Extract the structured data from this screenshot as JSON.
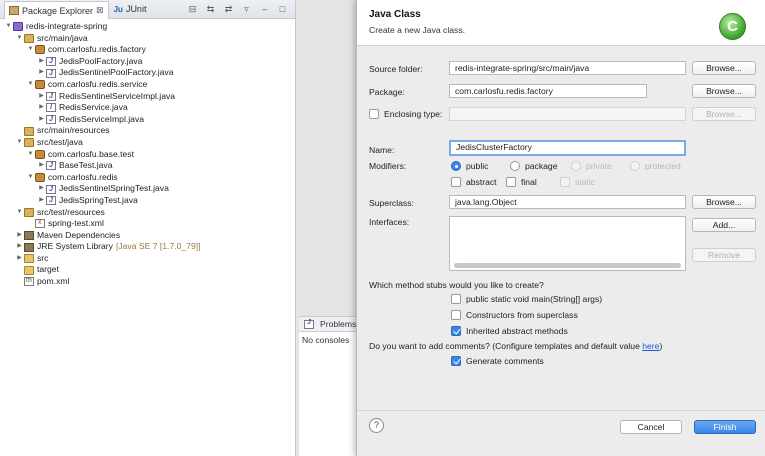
{
  "explorer": {
    "tabs": [
      {
        "label": "Package Explorer"
      },
      {
        "label": "JUnit"
      }
    ],
    "tab_close": "⊠",
    "ju_glyph": "Ju",
    "tools": [
      "⊟",
      "⇆",
      "⇄",
      "▿",
      "–",
      "□"
    ],
    "tree": [
      {
        "label": "redis-integrate-spring",
        "icon": "project-icon",
        "depth": 0,
        "tw": "▼"
      },
      {
        "label": "src/main/java",
        "icon": "source-folder-icon",
        "depth": 1,
        "tw": "▼"
      },
      {
        "label": "com.carlosfu.redis.factory",
        "icon": "package-icon",
        "depth": 2,
        "tw": "▼"
      },
      {
        "label": "JedisPoolFactory.java",
        "icon": "java-file-icon",
        "depth": 3,
        "tw": "▶"
      },
      {
        "label": "JedisSentinelPoolFactory.java",
        "icon": "java-file-icon",
        "depth": 3,
        "tw": "▶"
      },
      {
        "label": "com.carlosfu.redis.service",
        "icon": "package-icon",
        "depth": 2,
        "tw": "▼"
      },
      {
        "label": "RedisSentinelServiceImpl.java",
        "icon": "java-file-icon",
        "depth": 3,
        "tw": "▶"
      },
      {
        "label": "RedisService.java",
        "icon": "interface-file-icon",
        "depth": 3,
        "tw": "▶"
      },
      {
        "label": "RedisServiceImpl.java",
        "icon": "java-file-icon",
        "depth": 3,
        "tw": "▶"
      },
      {
        "label": "src/main/resources",
        "icon": "source-folder-icon",
        "depth": 1,
        "tw": ""
      },
      {
        "label": "src/test/java",
        "icon": "source-folder-icon",
        "depth": 1,
        "tw": "▼"
      },
      {
        "label": "com.carlosfu.base.test",
        "icon": "package-icon",
        "depth": 2,
        "tw": "▼"
      },
      {
        "label": "BaseTest.java",
        "icon": "java-file-icon",
        "depth": 3,
        "tw": "▶"
      },
      {
        "label": "com.carlosfu.redis",
        "icon": "package-icon",
        "depth": 2,
        "tw": "▼"
      },
      {
        "label": "JedisSentinelSpringTest.java",
        "icon": "java-file-icon",
        "depth": 3,
        "tw": "▶"
      },
      {
        "label": "JedisSpringTest.java",
        "icon": "java-file-icon",
        "depth": 3,
        "tw": "▶"
      },
      {
        "label": "src/test/resources",
        "icon": "source-folder-icon",
        "depth": 1,
        "tw": "▼"
      },
      {
        "label": "spring-test.xml",
        "icon": "xml-file-icon",
        "depth": 2,
        "tw": ""
      },
      {
        "label": "Maven Dependencies",
        "icon": "library-icon",
        "depth": 1,
        "tw": "▶"
      },
      {
        "label": "JRE System Library",
        "suffix": "[Java SE 7 [1.7.0_79]]",
        "icon": "library-icon",
        "depth": 1,
        "tw": "▶"
      },
      {
        "label": "src",
        "icon": "folder-icon",
        "depth": 1,
        "tw": "▶"
      },
      {
        "label": "target",
        "icon": "folder-icon",
        "depth": 1,
        "tw": ""
      },
      {
        "label": "pom.xml",
        "icon": "maven-file-icon",
        "depth": 1,
        "tw": ""
      }
    ]
  },
  "console": {
    "tab_label": "Problems",
    "text": "No consoles"
  },
  "dialog": {
    "title": "Java Class",
    "subtitle": "Create a new Java class.",
    "logo": "C",
    "source_folder": {
      "label": "Source folder:",
      "value": "redis-integrate-spring/src/main/java",
      "button": "Browse..."
    },
    "package": {
      "label": "Package:",
      "value": "com.carlosfu.redis.factory",
      "button": "Browse..."
    },
    "enclosing": {
      "label": "Enclosing type:",
      "value": "",
      "button": "Browse..."
    },
    "name": {
      "label": "Name:",
      "value": "JedisClusterFactory"
    },
    "modifiers": {
      "label": "Modifiers:",
      "public": "public",
      "package": "package",
      "private": "private",
      "protected": "protected",
      "abstract": "abstract",
      "final": "final",
      "static": "static"
    },
    "superclass": {
      "label": "Superclass:",
      "value": "java.lang.Object",
      "button": "Browse..."
    },
    "interfaces": {
      "label": "Interfaces:",
      "add": "Add...",
      "remove": "Remove"
    },
    "stubs_question": "Which method stubs would you like to create?",
    "stub_main": "public static void main(String[] args)",
    "stub_ctor": "Constructors from superclass",
    "stub_inherited": "Inherited abstract methods",
    "comments_question": "Do you want to add comments? (Configure templates and default value ",
    "comments_link": "here",
    "comments_close": ")",
    "generate_comments": "Generate comments",
    "help": "?",
    "cancel": "Cancel",
    "finish": "Finish"
  }
}
